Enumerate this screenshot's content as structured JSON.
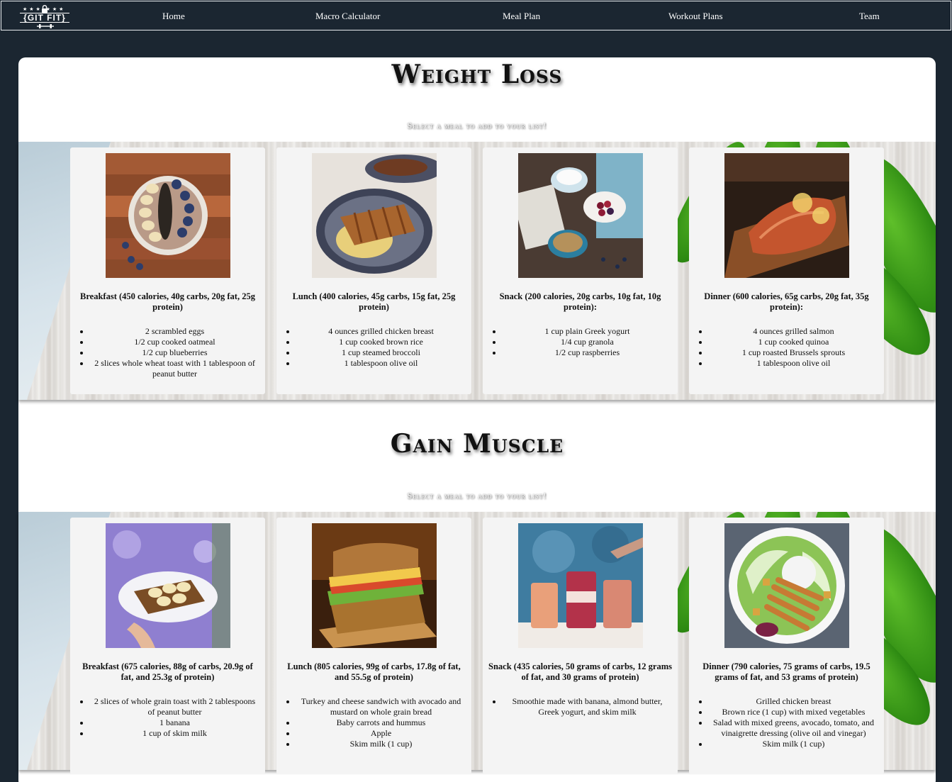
{
  "nav": {
    "logo_text": "{GIT FIT}",
    "logo_stars": "★★★ ★★★",
    "links": [
      "Home",
      "Macro Calculator",
      "Meal Plan",
      "Workout Plans",
      "Team"
    ]
  },
  "sections": [
    {
      "title": "Weight Loss",
      "subtitle": "Select a meal to add to your list!",
      "meals": [
        {
          "title": "Breakfast (450 calories, 40g carbs, 20g fat, 25g protein)",
          "items": [
            "2 scrambled eggs",
            "1/2 cup cooked oatmeal",
            "1/2 cup blueberries",
            "2 slices whole wheat toast with 1 tablespoon of peanut butter"
          ]
        },
        {
          "title": "Lunch (400 calories, 45g carbs, 15g fat, 25g protein)",
          "items": [
            "4 ounces grilled chicken breast",
            "1 cup cooked brown rice",
            "1 cup steamed broccoli",
            "1 tablespoon olive oil"
          ]
        },
        {
          "title": "Snack (200 calories, 20g carbs, 10g fat, 10g protein):",
          "items": [
            "1 cup plain Greek yogurt",
            "1/4 cup granola",
            "1/2 cup raspberries"
          ]
        },
        {
          "title": "Dinner (600 calories, 65g carbs, 20g fat, 35g protein):",
          "items": [
            "4 ounces grilled salmon",
            "1 cup cooked quinoa",
            "1 cup roasted Brussels sprouts",
            "1 tablespoon olive oil"
          ]
        }
      ]
    },
    {
      "title": "Gain Muscle",
      "subtitle": "Select a meal to add to your list!",
      "meals": [
        {
          "title": "Breakfast (675 calories, 88g of carbs, 20.9g of fat, and 25.3g of protein)",
          "items": [
            "2 slices of whole grain toast with 2 tablespoons of peanut butter",
            "1 banana",
            "1 cup of skim milk"
          ]
        },
        {
          "title": "Lunch (805 calories, 99g of carbs, 17.8g of fat, and 55.5g of protein)",
          "items": [
            "Turkey and cheese sandwich with avocado and mustard on whole grain bread",
            "Baby carrots and hummus",
            "Apple",
            "Skim milk (1 cup)"
          ]
        },
        {
          "title": "Snack (435 calories, 50 grams of carbs, 12 grams of fat, and 30 grams of protein)",
          "items": [
            "Smoothie made with banana, almond butter, Greek yogurt, and skim milk"
          ]
        },
        {
          "title": "Dinner (790 calories, 75 grams of carbs, 19.5 grams of fat, and 53 grams of protein)",
          "items": [
            "Grilled chicken breast",
            "Brown rice (1 cup) with mixed vegetables",
            "Salad with mixed greens, avocado, tomato, and vinaigrette dressing (olive oil and vinegar)",
            "Skim milk (1 cup)"
          ]
        }
      ]
    }
  ]
}
